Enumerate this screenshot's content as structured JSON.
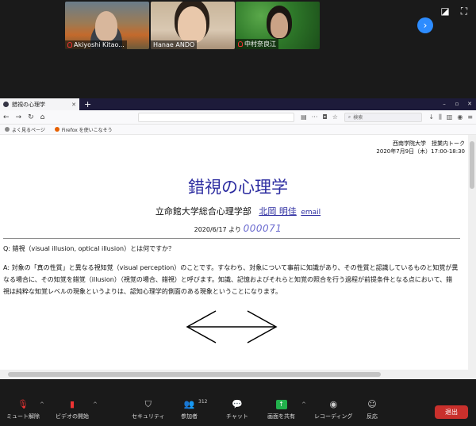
{
  "gallery": {
    "participants": [
      {
        "name": "Akiyoshi Kitao..."
      },
      {
        "name": "Hanae ANDO"
      },
      {
        "name": "中村奈良江"
      }
    ]
  },
  "browser": {
    "tab_title": "錯視の心理学",
    "search_placeholder": "検索",
    "bookmarks": [
      {
        "label": "よく見るページ"
      },
      {
        "label": "Firefox を使いこなそう"
      }
    ]
  },
  "page": {
    "event_line1": "西南学院大学　授業内トーク",
    "event_line2": "2020年7月9日（木）17:00-18:30",
    "title": "錯視の心理学",
    "affiliation": "立命館大学総合心理学部",
    "author_name": "北岡 明佳",
    "email_link": "email",
    "counter_prefix": "2020/6/17 より",
    "counter_value": "000071",
    "question": "Q: 錯視（visual illusion, optical illusion）とは何ですか？",
    "answer": "A: 対象の「真の性質」と異なる視知覚（visual perception）のことです。すなわち、対象について事前に知識があり、その性質と認識しているものと知覚が異なる場合に、その知覚を錯覚（illusion）（視覚の場合、錯視）と呼びます。知識、記憶およびそれらと知覚の照合を行う過程が前提条件となる点において、錯視は純粋な知覚レベルの現象というよりは、認知心理学的側面のある現象ということになります。"
  },
  "controls": {
    "mute": "ミュート解除",
    "video": "ビデオの開始",
    "security": "セキュリティ",
    "participants": "参加者",
    "participants_count": "312",
    "chat": "チャット",
    "share": "画面を共有",
    "record": "レコーディング",
    "reactions": "反応",
    "leave": "退出"
  },
  "colors": {
    "zoom_dark": "#1a1a1a",
    "title_blue": "#2c2ca0",
    "share_green": "#22b14c",
    "leave_red": "#c9302c"
  }
}
